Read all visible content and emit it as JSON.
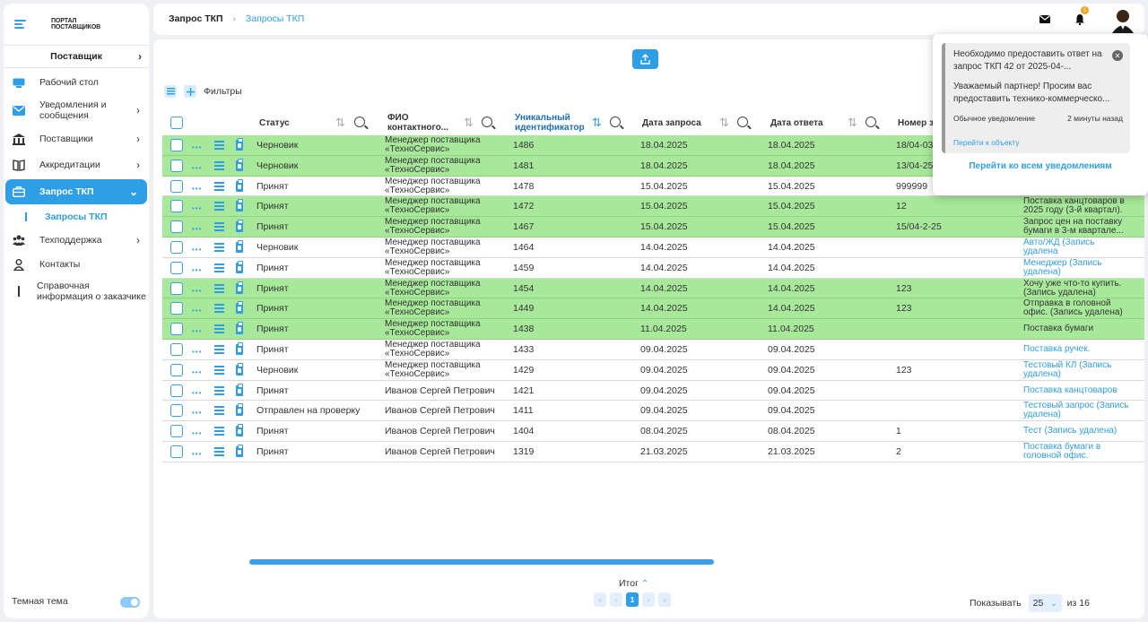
{
  "logo": {
    "line1": "ПОРТАЛ",
    "line2": "ПОСТАВЩИКОВ"
  },
  "role": {
    "label": "Поставщик"
  },
  "nav": {
    "desktop": "Рабочий стол",
    "notifications": "Уведомления и сообщения",
    "suppliers": "Поставщики",
    "accreditations": "Аккредитации",
    "tkp": "Запрос ТКП",
    "tkp_sub": "Запросы ТКП",
    "support": "Техподдержка",
    "contacts": "Контакты",
    "reference": "Справочная информация о заказчике"
  },
  "theme": {
    "label": "Темная тема"
  },
  "breadcrumb": {
    "section": "Запрос ТКП",
    "page": "Запросы ТКП"
  },
  "header": {
    "bell_badge": "1"
  },
  "toolbar": {
    "filters_label": "Фильтры"
  },
  "table": {
    "columns": {
      "status": "Статус",
      "fio": "ФИО контактного...",
      "uid": "Уникальный идентификатор",
      "request_date": "Дата запроса",
      "answer_date": "Дата ответа",
      "number": "Номер з"
    },
    "rows": [
      {
        "status": "Черновик",
        "fio": "Менеджер поставщика «ТехноСервис»",
        "uid": "1486",
        "request_date": "18.04.2025",
        "answer_date": "18.04.2025",
        "number": "18/04-03",
        "subject": ""
      },
      {
        "status": "Черновик",
        "fio": "Менеджер поставщика «ТехноСервис»",
        "uid": "1481",
        "request_date": "18.04.2025",
        "answer_date": "18.04.2025",
        "number": "13/04-25",
        "subject": ""
      },
      {
        "status": "Принят",
        "fio": "Менеджер поставщика «ТехноСервис»",
        "uid": "1478",
        "request_date": "15.04.2025",
        "answer_date": "15.04.2025",
        "number": "999999",
        "subject": ""
      },
      {
        "status": "Принят",
        "fio": "Менеджер поставщика «ТехноСервис»",
        "uid": "1472",
        "request_date": "15.04.2025",
        "answer_date": "15.04.2025",
        "number": "12",
        "subject": "Поставка канцтоваров в 2025 году (3-й квартал)."
      },
      {
        "status": "Принят",
        "fio": "Менеджер поставщика «ТехноСервис»",
        "uid": "1467",
        "request_date": "15.04.2025",
        "answer_date": "15.04.2025",
        "number": "15/04-2-25",
        "subject": "Запрос цен на поставку бумаги в 3-м квартале..."
      },
      {
        "status": "Черновик",
        "fio": "Менеджер поставщика «ТехноСервис»",
        "uid": "1464",
        "request_date": "14.04.2025",
        "answer_date": "14.04.2025",
        "number": "",
        "subject": "Авто/ЖД (Запись удалена"
      },
      {
        "status": "Принят",
        "fio": "Менеджер поставщика «ТехноСервис»",
        "uid": "1459",
        "request_date": "14.04.2025",
        "answer_date": "14.04.2025",
        "number": "",
        "subject": "Менеджер (Запись удалена)"
      },
      {
        "status": "Принят",
        "fio": "Менеджер поставщика «ТехноСервис»",
        "uid": "1454",
        "request_date": "14.04.2025",
        "answer_date": "14.04.2025",
        "number": "123",
        "subject": "Хочу уже что-то купить. (Запись удалена)"
      },
      {
        "status": "Принят",
        "fio": "Менеджер поставщика «ТехноСервис»",
        "uid": "1449",
        "request_date": "14.04.2025",
        "answer_date": "14.04.2025",
        "number": "123",
        "subject": "Отправка в головной офис. (Запись удалена)"
      },
      {
        "status": "Принят",
        "fio": "Менеджер поставщика «ТехноСервис»",
        "uid": "1438",
        "request_date": "11.04.2025",
        "answer_date": "11.04.2025",
        "number": "",
        "subject": "Поставка бумаги"
      },
      {
        "status": "Принят",
        "fio": "Менеджер поставщика «ТехноСервис»",
        "uid": "1433",
        "request_date": "09.04.2025",
        "answer_date": "09.04.2025",
        "number": "",
        "subject": "Поставка ручек."
      },
      {
        "status": "Черновик",
        "fio": "Менеджер поставщика «ТехноСервис»",
        "uid": "1429",
        "request_date": "09.04.2025",
        "answer_date": "09.04.2025",
        "number": "123",
        "subject": "Тестовый КЛ (Запись удалена)"
      },
      {
        "status": "Принят",
        "fio": "Иванов Сергей Петрович",
        "uid": "1421",
        "request_date": "09.04.2025",
        "answer_date": "09.04.2025",
        "number": "",
        "subject": "Поставка канцтоваров"
      },
      {
        "status": "Отправлен на проверку",
        "fio": "Иванов Сергей Петрович",
        "uid": "1411",
        "request_date": "09.04.2025",
        "answer_date": "09.04.2025",
        "number": "",
        "subject": "Тестовый запрос (Запись удалена)"
      },
      {
        "status": "Принят",
        "fio": "Иванов Сергей Петрович",
        "uid": "1404",
        "request_date": "08.04.2025",
        "answer_date": "08.04.2025",
        "number": "1",
        "subject": "Тест (Запись удалена)"
      },
      {
        "status": "Принят",
        "fio": "Иванов Сергей Петрович",
        "uid": "1319",
        "request_date": "21.03.2025",
        "answer_date": "21.03.2025",
        "number": "2",
        "subject": "Поставка бумаги в головной офис."
      }
    ]
  },
  "footer": {
    "total_label": "Итог",
    "current_page": "1",
    "show_label": "Показывать",
    "page_size": "25",
    "of_pages": "из 16"
  },
  "notification": {
    "title": "Необходимо предоставить ответ на запрос ТКП 42 от 2025-04-...",
    "body": "Уважаемый партнер! Просим вас предоставить технико-коммерческо...",
    "type": "Обычное уведомление",
    "time": "2 минуты назад",
    "link": "Перейти к объекту",
    "all_link": "Перейти ко всем уведомлениям"
  },
  "colors": {
    "accent": "#2e9fe6",
    "row_highlight": "#a7e89a",
    "badge": "#f5a623"
  },
  "icons": {
    "desktop": "monitor-icon",
    "notifications": "envelope-icon",
    "suppliers": "building-icon",
    "accreditations": "book-icon",
    "tkp": "briefcase-icon",
    "support": "people-icon",
    "contacts": "person-icon"
  }
}
